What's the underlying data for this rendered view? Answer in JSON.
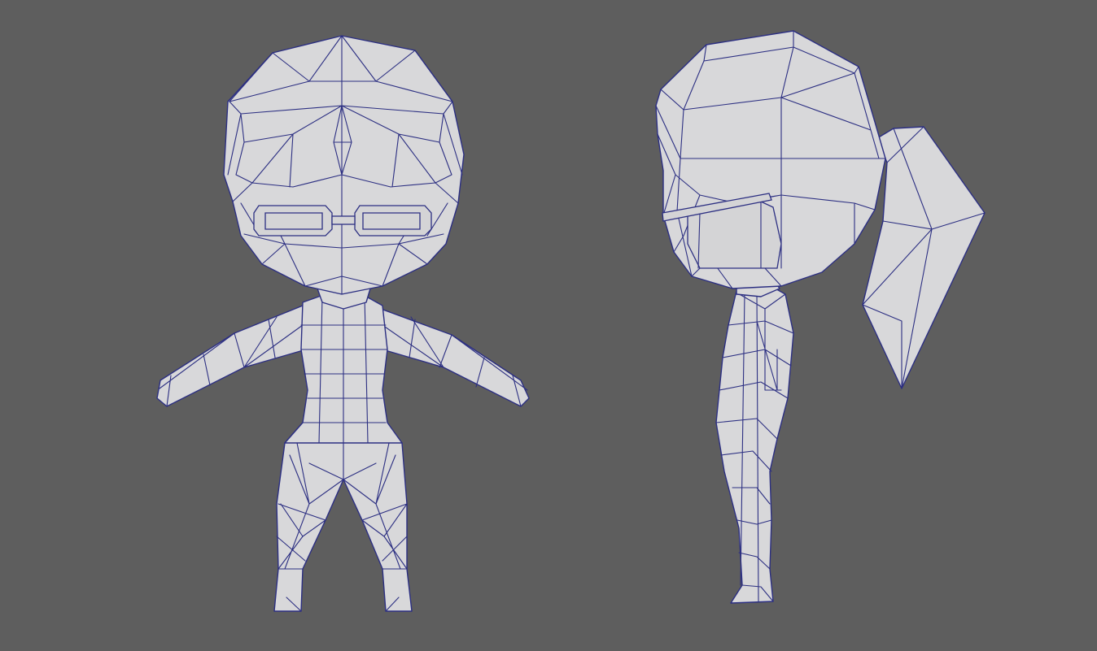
{
  "viewport": {
    "background": "#5e5e5e",
    "mesh_fill": "#d8d8da",
    "wire_color": "#2c2f82"
  },
  "models": [
    {
      "view": "front",
      "description_icon": "low-poly-chibi-front-mesh"
    },
    {
      "view": "side",
      "description_icon": "low-poly-chibi-side-mesh"
    }
  ]
}
